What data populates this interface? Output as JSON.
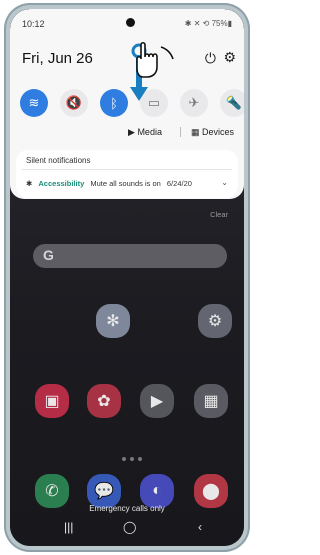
{
  "status": {
    "time": "10:12",
    "right": "✱ ✕ ⟲ 75%▮"
  },
  "header": {
    "date": "Fri, Jun 26"
  },
  "quick_toggles": [
    {
      "name": "wifi",
      "state": "on",
      "icon": "wifi-icon"
    },
    {
      "name": "sound-off",
      "state": "off",
      "icon": "mute-icon"
    },
    {
      "name": "bluetooth",
      "state": "on",
      "icon": "bluetooth-icon"
    },
    {
      "name": "rotate",
      "state": "off",
      "icon": "rotate-icon"
    },
    {
      "name": "airplane",
      "state": "off",
      "icon": "airplane-icon"
    },
    {
      "name": "flashlight",
      "state": "off",
      "icon": "flashlight-icon"
    }
  ],
  "media_row": {
    "media": "Media",
    "devices": "Devices"
  },
  "notification": {
    "section_title": "Silent notifications",
    "app_name": "Accessibility",
    "message": "Mute all sounds is on",
    "date": "6/24/20"
  },
  "panel_actions": {
    "settings": "Notification settings",
    "clear": "Clear"
  },
  "home": {
    "search_letter": "G",
    "emergency": "Emergency calls only"
  },
  "navbar": {
    "recent": "|||",
    "home": "◯",
    "back": "‹"
  },
  "colors": {
    "accent": "#2f7de1",
    "accessibility_green": "#1b8e7a",
    "gesture_blue": "#1a7fc1"
  }
}
